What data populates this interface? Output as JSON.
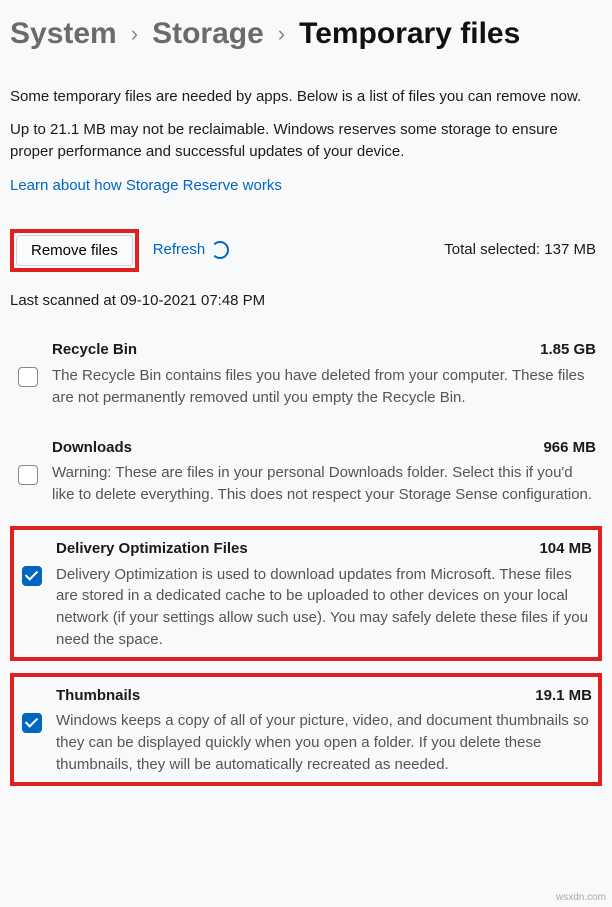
{
  "breadcrumb": {
    "system": "System",
    "storage": "Storage",
    "current": "Temporary files"
  },
  "intro": {
    "line1": "Some temporary files are needed by apps. Below is a list of files you can remove now.",
    "line2": "Up to 21.1 MB may not be reclaimable. Windows reserves some storage to ensure proper performance and successful updates of your device.",
    "link": "Learn about how Storage Reserve works"
  },
  "toolbar": {
    "remove": "Remove files",
    "refresh": "Refresh",
    "total": "Total selected: 137 MB"
  },
  "scanned": "Last scanned at 09-10-2021 07:48 PM",
  "items": [
    {
      "title": "Recycle Bin",
      "size": "1.85 GB",
      "desc": "The Recycle Bin contains files you have deleted from your computer. These files are not permanently removed until you empty the Recycle Bin.",
      "checked": false,
      "highlight": false
    },
    {
      "title": "Downloads",
      "size": "966 MB",
      "desc": "Warning: These are files in your personal Downloads folder. Select this if you'd like to delete everything. This does not respect your Storage Sense configuration.",
      "checked": false,
      "highlight": false
    },
    {
      "title": "Delivery Optimization Files",
      "size": "104 MB",
      "desc": "Delivery Optimization is used to download updates from Microsoft. These files are stored in a dedicated cache to be uploaded to other devices on your local network (if your settings allow such use). You may safely delete these files if you need the space.",
      "checked": true,
      "highlight": true
    },
    {
      "title": "Thumbnails",
      "size": "19.1 MB",
      "desc": "Windows keeps a copy of all of your picture, video, and document thumbnails so they can be displayed quickly when you open a folder. If you delete these thumbnails, they will be automatically recreated as needed.",
      "checked": true,
      "highlight": true
    }
  ],
  "watermark": "wsxdn.com"
}
